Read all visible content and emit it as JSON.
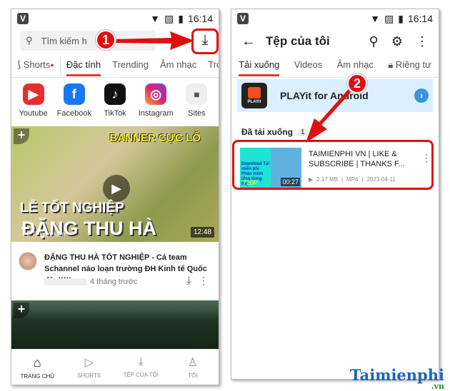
{
  "status": {
    "time": "16:14"
  },
  "left": {
    "search_placeholder": "Tìm kiếm h",
    "tabs": [
      "Shorts",
      "Đặc tính",
      "Trending",
      "Âm nhạc",
      "Trò chơ"
    ],
    "apps": [
      {
        "label": "Youtube",
        "color": "#e62e2e"
      },
      {
        "label": "Facebook",
        "color": "#1877f2"
      },
      {
        "label": "TikTok",
        "color": "#111111"
      },
      {
        "label": "Instagram",
        "color": "#d6287a"
      },
      {
        "label": "Sites",
        "color": "#eeeeee"
      }
    ],
    "video": {
      "banner": "BANNER CỰC LỐ",
      "line1": "LỄ TỐT NGHIỆP",
      "line2": "ĐẶNG THU HÀ",
      "duration": "12:48",
      "views": "1,2 Tr lượt xem",
      "title": "ĐẶNG THU HÀ TỐT NGHIỆP - Cả team Schannel náo loạn trường ĐH Kinh tế Quốc dân!!!!!",
      "age": "4 tháng trước"
    },
    "nav": [
      "TRANG CHỦ",
      "SHORTS",
      "TỆP CỦA TÔI",
      "TÔI"
    ]
  },
  "right": {
    "title": "Tệp của tôi",
    "tabs": [
      "Tải xuống",
      "Videos",
      "Âm nhạc",
      "Riêng tư"
    ],
    "ad": {
      "title": "PLAYit for Android",
      "logo": "PLAYit"
    },
    "section": "Đã tải xuống",
    "count": "1",
    "item": {
      "title": "TAIMIENPHI VN | LIKE & SUBSCRIBE | THANKS F...",
      "size": "2,17 MB",
      "format": "MP4",
      "date": "2023-04-11",
      "duration": "00:27",
      "quality": "720P",
      "thumb_text": "Download Tải miễn phí Phần mềm Ứng dụng hay"
    }
  },
  "annotations": {
    "step1": "1",
    "step2": "2",
    "color": "#e01010"
  },
  "watermark": {
    "brand": "Taimienphi",
    "tld": ".vn"
  }
}
